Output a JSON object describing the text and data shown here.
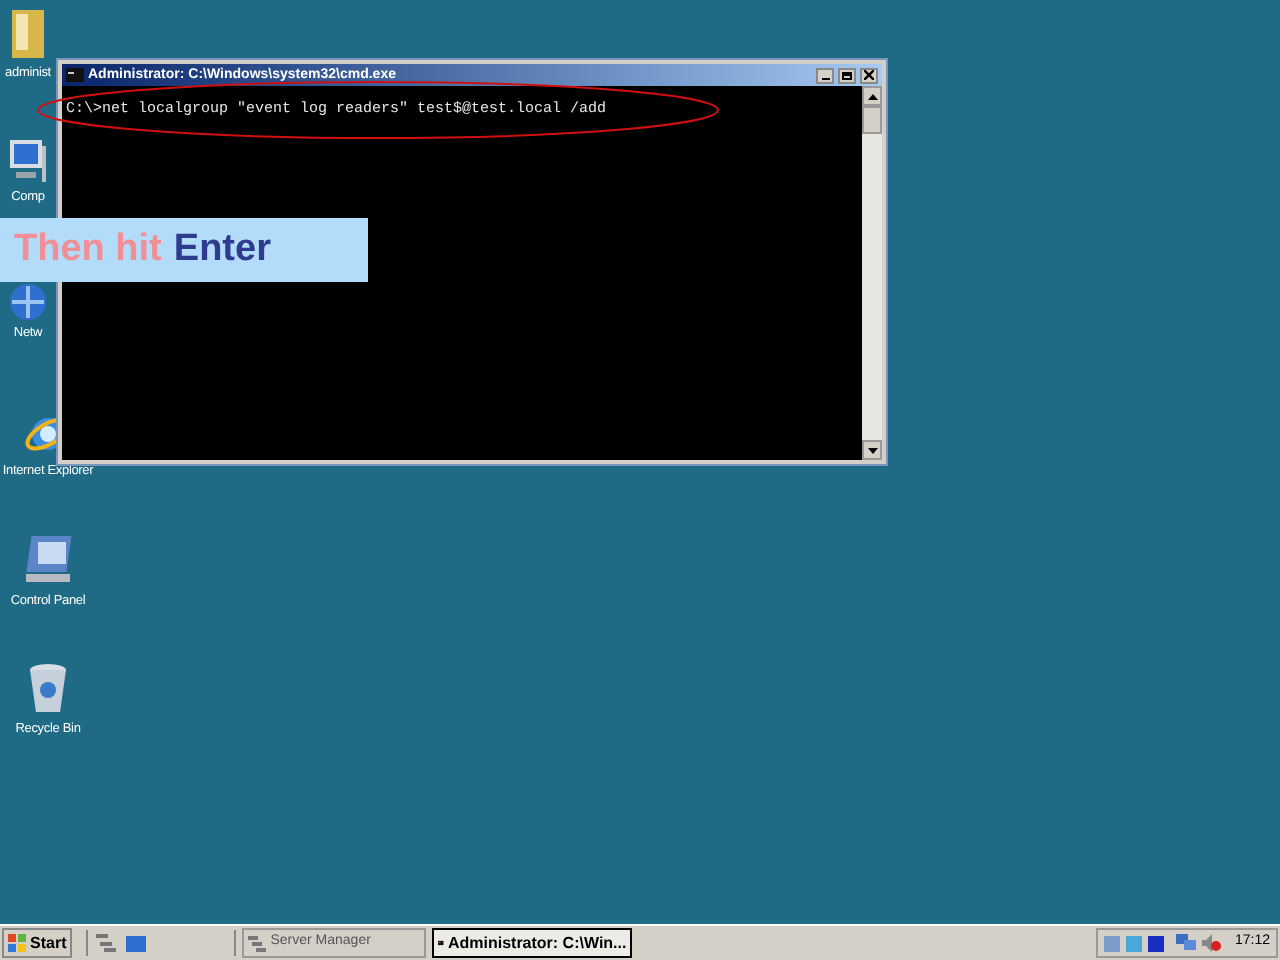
{
  "desktop_icons": [
    {
      "kind": "folder",
      "label": "administ"
    },
    {
      "kind": "computer",
      "label": "Comp"
    },
    {
      "kind": "network",
      "label": "Netw"
    },
    {
      "kind": "browser",
      "label": "Internet Explorer"
    },
    {
      "kind": "control-panel",
      "label": "Control Panel"
    },
    {
      "kind": "recycle-bin",
      "label": "Recycle Bin"
    }
  ],
  "window": {
    "title": "Administrator: C:\\Windows\\system32\\cmd.exe",
    "command": "C:\\>net localgroup \"event log readers\" test$@test.local /add"
  },
  "callout": {
    "lead": "Then hit",
    "emphasis": "Enter"
  },
  "taskbar": {
    "start": "Start",
    "tasks": [
      {
        "label": "Server Manager",
        "selected": false
      },
      {
        "label": "Administrator: C:\\Win...",
        "selected": true
      }
    ],
    "clock": "17:12"
  }
}
